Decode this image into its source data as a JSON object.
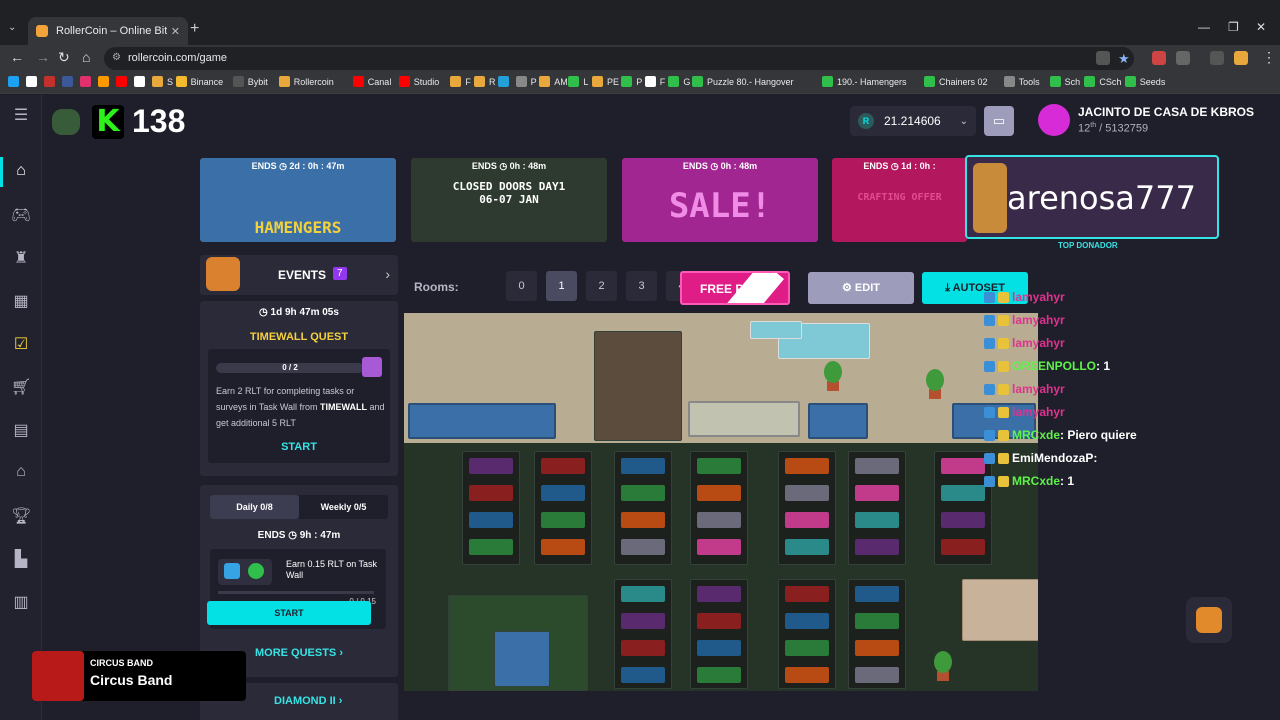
{
  "browser": {
    "tab_title": "RollerCoin – Online Bitcoin Min",
    "url": "rollercoin.com/game",
    "bookmarks": [
      {
        "label": "",
        "color": "#1da1f2"
      },
      {
        "label": "",
        "color": "#fff"
      },
      {
        "label": "",
        "color": "#c4302b"
      },
      {
        "label": "",
        "color": "#3b5998"
      },
      {
        "label": "",
        "color": "#e1306c"
      },
      {
        "label": "",
        "color": "#ff9900"
      },
      {
        "label": "",
        "color": "#ff0000"
      },
      {
        "label": "",
        "color": "#fff"
      },
      {
        "label": "S",
        "color": "#e8a83b"
      },
      {
        "label": "Binance",
        "color": "#f3ba2f"
      },
      {
        "label": "Bybit",
        "color": "#555"
      },
      {
        "label": "Rollercoin",
        "color": "#e8a83b"
      },
      {
        "label": "Canal",
        "color": "#ff0000"
      },
      {
        "label": "Studio",
        "color": "#ff0000"
      },
      {
        "label": "F",
        "color": "#e8a83b"
      },
      {
        "label": "R",
        "color": "#e8a83b"
      },
      {
        "label": "",
        "color": "#229ed9"
      },
      {
        "label": "P",
        "color": "#888"
      },
      {
        "label": "AM",
        "color": "#e8a83b"
      },
      {
        "label": "L",
        "color": "#2fbf4a"
      },
      {
        "label": "PE",
        "color": "#e8a83b"
      },
      {
        "label": "P",
        "color": "#2fbf4a"
      },
      {
        "label": "F",
        "color": "#fff"
      },
      {
        "label": "G",
        "color": "#2fbf4a"
      },
      {
        "label": "Puzzle 80.- Hangover",
        "color": "#2fbf4a"
      },
      {
        "label": "190.- Hamengers",
        "color": "#2fbf4a"
      },
      {
        "label": "Chainers 02",
        "color": "#2fbf4a"
      },
      {
        "label": "Tools",
        "color": "#888"
      },
      {
        "label": "Sch",
        "color": "#2fbf4a"
      },
      {
        "label": "CSch",
        "color": "#2fbf4a"
      },
      {
        "label": "Seeds",
        "color": "#2fbf4a"
      }
    ]
  },
  "header": {
    "level": "138",
    "balance": "21.214606",
    "balance_currency_symbol": "R",
    "profile_name": "JACINTO DE CASA DE KBROS",
    "rank_place": "12",
    "rank_suffix": "th",
    "rank_total": "/ 5132759"
  },
  "banners": [
    {
      "ends": "ENDS ◷ 2d : 0h : 47m",
      "title": "HAMENGERS",
      "bg": "#3b6fa8",
      "color": "#f3d13a"
    },
    {
      "ends": "ENDS ◷ 0h : 48m",
      "title": "CLOSED DOORS DAY1\n06-07 JAN",
      "bg": "#2e3a2f",
      "color": "#fff"
    },
    {
      "ends": "ENDS ◷ 0h : 48m",
      "title": "SALE!",
      "bg": "#a12692",
      "color": "#f18ce6"
    },
    {
      "ends": "ENDS ◷ 1d : 0h :",
      "title": "CRAFTING OFFER",
      "bg": "#b3175e",
      "color": "#e04c8e"
    }
  ],
  "donor": {
    "name": "arenosa777",
    "label": "TOP DONADOR"
  },
  "events": {
    "label": "EVENTS",
    "count": "7"
  },
  "timewall": {
    "timer": "◷ 1d 9h 47m 05s",
    "title": "TIMEWALL QUEST",
    "progress": "0 / 2",
    "desc_prefix": "Earn 2 RLT for completing tasks or surveys in Task Wall from ",
    "desc_bold": "TIMEWALL",
    "desc_suffix": " and get additional 5 RLT",
    "start": "START"
  },
  "quests": {
    "daily_tab": "Daily  0/8",
    "weekly_tab": "Weekly  0/5",
    "ends": "ENDS ◷ 9h : 47m",
    "task_desc": "Earn 0.15 RLT on Task Wall",
    "task_value": "0 / 0.15",
    "task_icon_nums": [
      "10",
      "5"
    ],
    "start": "START",
    "more": "MORE QUESTS  ›"
  },
  "diamond": "DIAMOND II  ›",
  "rooms": {
    "label": "Rooms:",
    "buttons": [
      "0",
      "1",
      "2",
      "3",
      "4"
    ],
    "active": "1"
  },
  "actions": {
    "free": "FREE P",
    "edit": "EDIT",
    "autoset": "AUTOSET"
  },
  "chat": [
    {
      "user": "lamyahyr",
      "msg": "",
      "color": "#e0328f"
    },
    {
      "user": "lamyahyr",
      "msg": "",
      "color": "#e0328f"
    },
    {
      "user": "lamyahyr",
      "msg": "",
      "color": "#e0328f"
    },
    {
      "user": "GREENPOLLO",
      "msg": " : 1",
      "color": "#5ef24a"
    },
    {
      "user": "lamyahyr",
      "msg": "",
      "color": "#e0328f"
    },
    {
      "user": "lamyahyr",
      "msg": "",
      "color": "#e0328f"
    },
    {
      "user": "MRCxde",
      "msg": " : Piero quiere",
      "color": "#5ef24a"
    },
    {
      "user": "EmiMendozaP",
      "msg": " : ",
      "color": "#fff"
    },
    {
      "user": "MRCxde",
      "msg": " : 1",
      "color": "#5ef24a"
    }
  ],
  "music": {
    "small": "CIRCUS BAND",
    "title": "Circus Band"
  }
}
